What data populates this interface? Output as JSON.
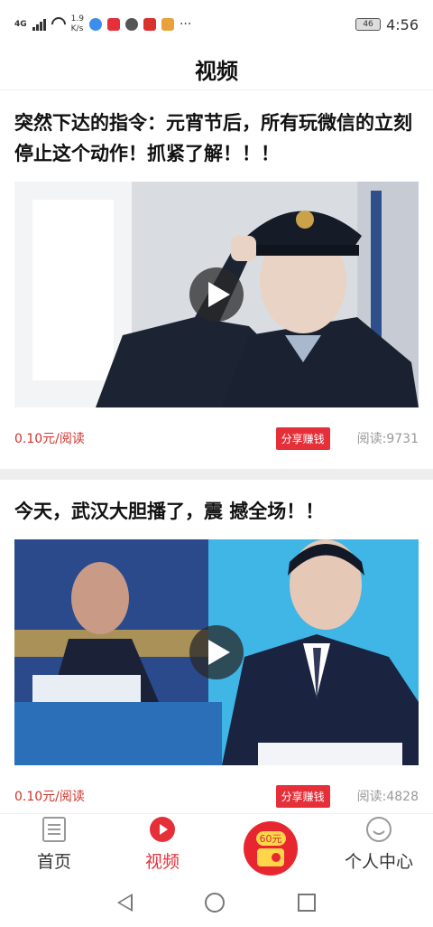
{
  "status_bar": {
    "network": "4G",
    "speed_value": "1.9",
    "speed_unit": "K/s",
    "battery": "46",
    "time": "4:56",
    "more": "···"
  },
  "header": {
    "title": "视频"
  },
  "feed": [
    {
      "title": "突然下达的指令：元宵节后，所有玩微信的立刻停止这个动作！抓紧了解！！！",
      "price": "0.10元/阅读",
      "share_label": "分享赚钱",
      "reads": "阅读:9731"
    },
    {
      "title": "今天，武汉大胆播了，震 撼全场！！",
      "price": "0.10元/阅读",
      "share_label": "分享赚钱",
      "reads": "阅读:4828"
    }
  ],
  "bottom_nav": {
    "home": "首页",
    "video": "视频",
    "reward_badge": "60元",
    "profile": "个人中心"
  },
  "colors": {
    "accent": "#e5303a",
    "price": "#d0342c"
  }
}
